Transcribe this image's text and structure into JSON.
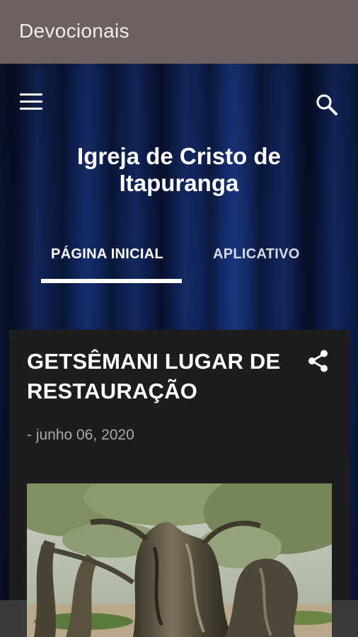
{
  "app": {
    "title": "Devocionais"
  },
  "header": {
    "site_title": "Igreja de Cristo de Itapuranga",
    "menu_icon": "menu-icon",
    "search_icon": "search-icon"
  },
  "tabs": [
    {
      "label": "PÁGINA INICIAL",
      "active": true
    },
    {
      "label": "APLICATIVO",
      "active": false
    }
  ],
  "post": {
    "title": "GETSÊMANI LUGAR DE RESTAURAÇÃO",
    "date": "- junho 06, 2020",
    "share_icon": "share-icon",
    "image": "olive-tree-photo"
  },
  "colors": {
    "appbar": "#6d6160",
    "hero": "#10265e",
    "card": "#1d1d1d",
    "date_text": "#a9a9a9"
  }
}
